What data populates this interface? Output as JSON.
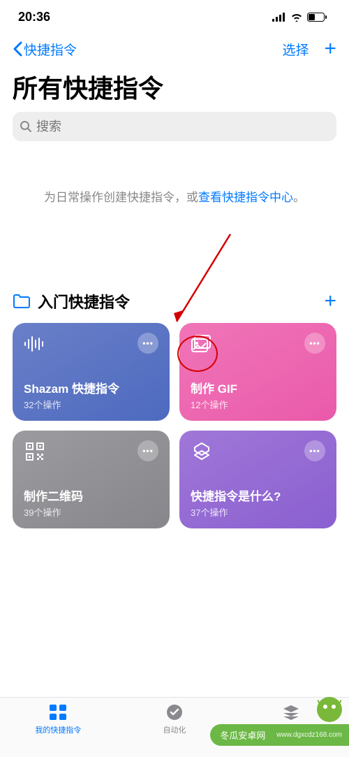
{
  "status": {
    "time": "20:36"
  },
  "nav": {
    "back": "快捷指令",
    "select": "选择"
  },
  "title": "所有快捷指令",
  "search": {
    "placeholder": "搜索"
  },
  "hint": {
    "pre": "为日常操作创建快捷指令，或",
    "link": "查看快捷指令中心",
    "post": "。"
  },
  "section": {
    "title": "入门快捷指令"
  },
  "cards": [
    {
      "title": "Shazam 快捷指令",
      "sub": "32个操作"
    },
    {
      "title": "制作 GIF",
      "sub": "12个操作"
    },
    {
      "title": "制作二维码",
      "sub": "39个操作"
    },
    {
      "title": "快捷指令是什么?",
      "sub": "37个操作"
    }
  ],
  "tabs": {
    "shortcuts": "我的快捷指令",
    "automation": "自动化",
    "gallery": ""
  },
  "watermark": {
    "text": "冬瓜安卓网",
    "url": "www.dgxcdz168.com"
  }
}
